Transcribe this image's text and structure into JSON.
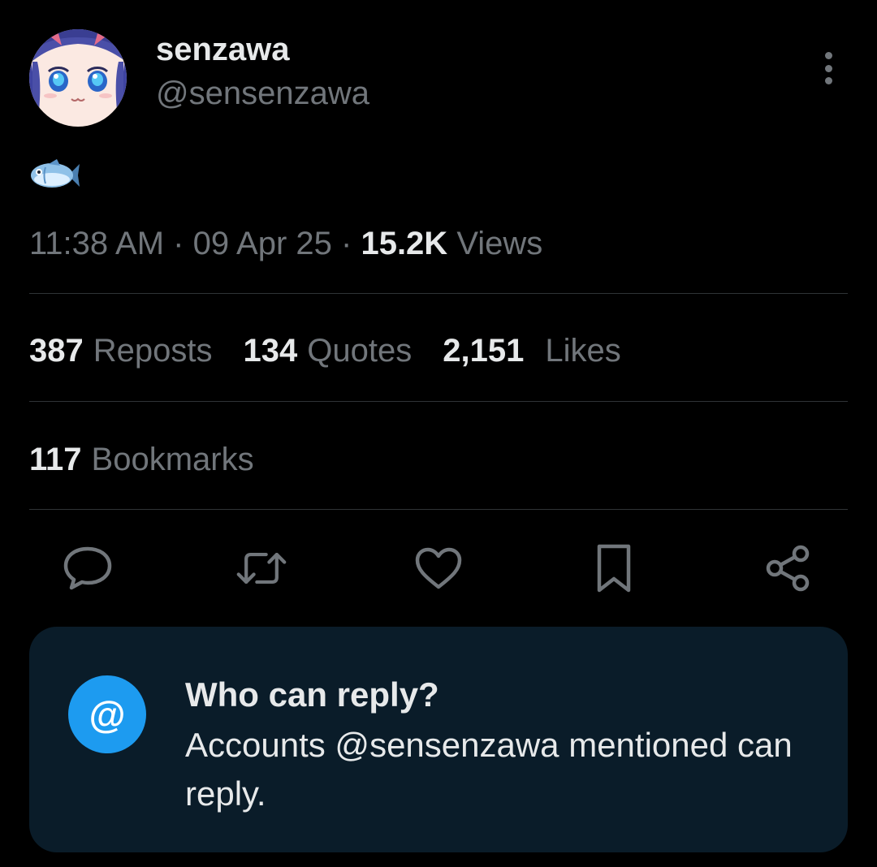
{
  "author": {
    "display_name": "senzawa",
    "handle": "@sensenzawa"
  },
  "post": {
    "content_emoji": "fish-emoji"
  },
  "meta": {
    "time": "11:38 AM",
    "separator": "·",
    "date": "09 Apr 25",
    "views_count": "15.2K",
    "views_label": "Views"
  },
  "stats": {
    "reposts": {
      "count": "387",
      "label": "Reposts"
    },
    "quotes": {
      "count": "134",
      "label": "Quotes"
    },
    "likes": {
      "count": "2,151",
      "label": "Likes"
    },
    "bookmarks": {
      "count": "117",
      "label": "Bookmarks"
    }
  },
  "actions": [
    "reply-icon",
    "repost-icon",
    "like-icon",
    "bookmark-icon",
    "share-icon"
  ],
  "reply_settings": {
    "icon_glyph": "@",
    "title": "Who can reply?",
    "description": "Accounts @sensenzawa mentioned can reply."
  },
  "colors": {
    "background": "#000000",
    "primary_text": "#e7e9ea",
    "secondary_text": "#71767b",
    "divider": "#2f3336",
    "accent": "#1d9bf0",
    "card_background": "#0a1c29"
  }
}
